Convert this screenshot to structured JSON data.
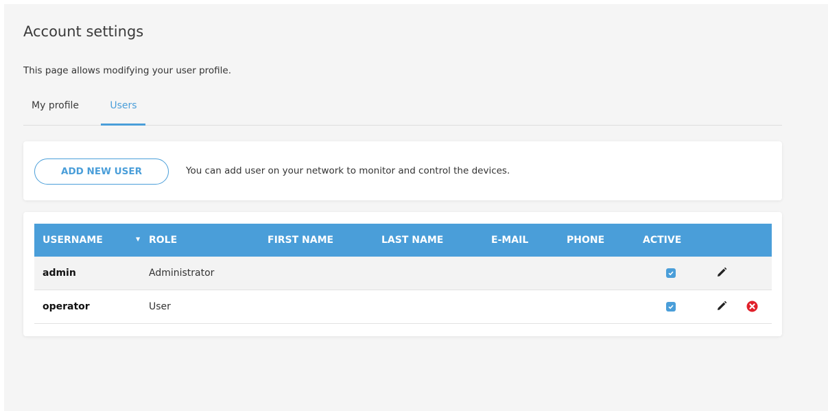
{
  "page": {
    "title": "Account settings",
    "description": "This page allows modifying your user profile."
  },
  "tabs": [
    {
      "label": "My profile",
      "active": false
    },
    {
      "label": "Users",
      "active": true
    }
  ],
  "add_user": {
    "button_label": "ADD NEW USER",
    "hint": "You can add user on your network to monitor and control the devices."
  },
  "table": {
    "columns": [
      "USERNAME",
      "ROLE",
      "FIRST NAME",
      "LAST NAME",
      "E-MAIL",
      "PHONE",
      "ACTIVE"
    ],
    "sort_indicator": "▼",
    "rows": [
      {
        "username": "admin",
        "role": "Administrator",
        "first_name": "",
        "last_name": "",
        "email": "",
        "phone": "",
        "active": true,
        "actions": [
          "edit-icon"
        ]
      },
      {
        "username": "operator",
        "role": "User",
        "first_name": "",
        "last_name": "",
        "email": "",
        "phone": "",
        "active": true,
        "actions": [
          "edit-icon",
          "delete-icon"
        ]
      }
    ]
  },
  "colors": {
    "accent": "#4a9ed9",
    "delete": "#e0202a",
    "background": "#f5f5f5"
  }
}
